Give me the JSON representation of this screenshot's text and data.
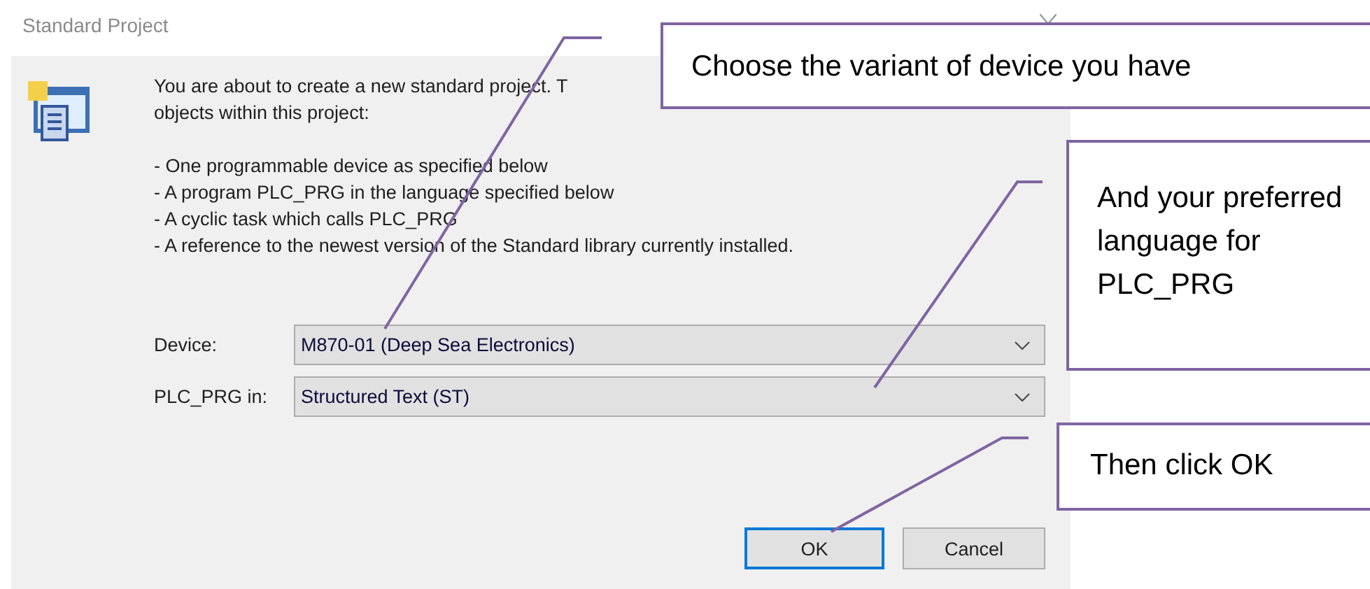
{
  "window": {
    "title": "Standard Project"
  },
  "intro": [
    "You are about to create a new standard project. T",
    "objects within this project:"
  ],
  "bullets": [
    "- One programmable device as specified below",
    "- A program PLC_PRG in the language specified below",
    "- A cyclic task which calls PLC_PRG",
    "- A reference to the newest version of the Standard library currently installed."
  ],
  "fields": [
    {
      "label": "Device:",
      "value": "M870-01 (Deep Sea Electronics)"
    },
    {
      "label": "PLC_PRG in:",
      "value": "Structured Text (ST)"
    }
  ],
  "buttons": [
    {
      "label": "OK",
      "default": true
    },
    {
      "label": "Cancel",
      "default": false
    }
  ],
  "callouts": [
    {
      "text": "Choose the variant of device you have"
    },
    {
      "text": "And your preferred language for PLC_PRG"
    },
    {
      "text": "Then click OK"
    }
  ]
}
